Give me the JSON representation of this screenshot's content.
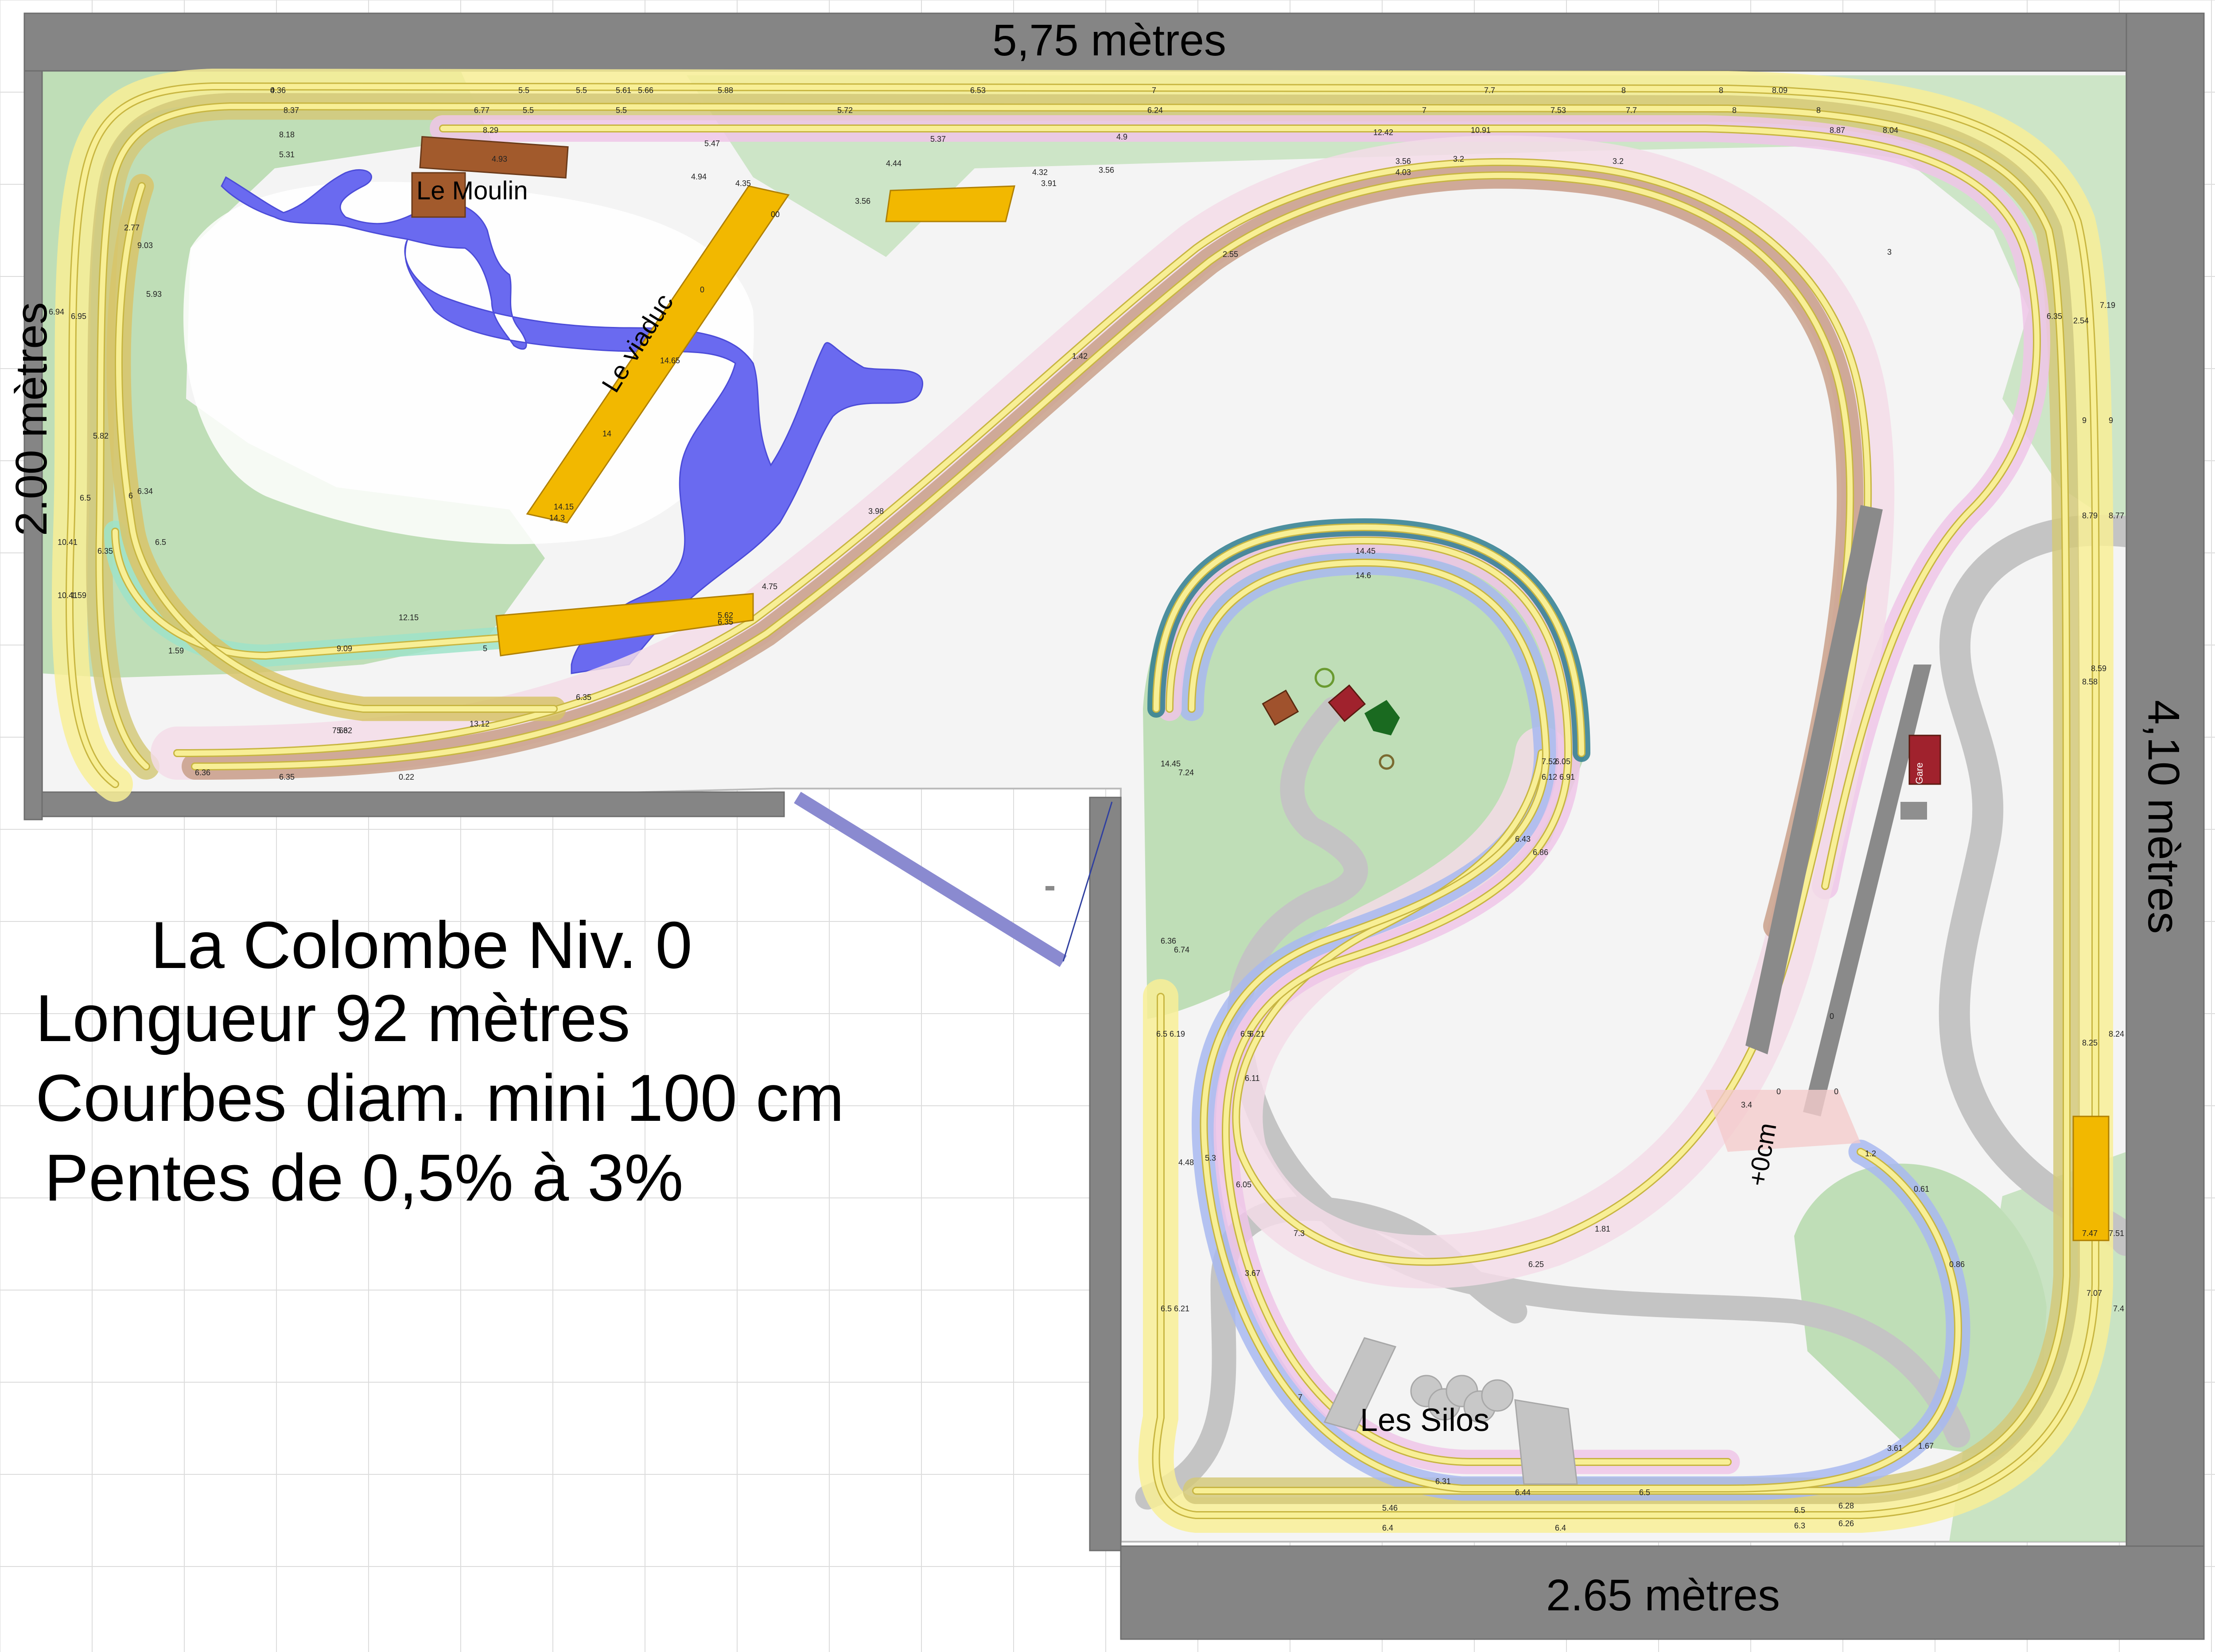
{
  "dimensions": {
    "top": "5,75 mètres",
    "left": "2.00 mètres",
    "right": "4,10 mètres",
    "bottom": "2.65 mètres"
  },
  "title_block": {
    "line1": "La Colombe Niv. 0",
    "line2": "Longueur 92 mètres",
    "line3": "Courbes diam. mini 100 cm",
    "line4": "Pentes de 0,5% à 3%"
  },
  "places": {
    "moulin": "Le Moulin",
    "viaduc": "Le viaduc",
    "silos": "Les Silos",
    "plus_zero": "+0cm",
    "gare": "Gare"
  },
  "track_heights": [
    "4.36",
    "5.5",
    "5.5",
    "5.61",
    "5.66",
    "5.88",
    "6.53",
    "7",
    "7.7",
    "8",
    "8",
    "8.09",
    "8.37",
    "6.77",
    "5.5",
    "5.5",
    "5.72",
    "6.24",
    "7",
    "7.53",
    "7.7",
    "8",
    "8",
    "8.18",
    "8.29",
    "5.37",
    "4.9",
    "12.42",
    "10.91",
    "8.87",
    "8.04",
    "5.31",
    "4.93",
    "5.47",
    "4.94",
    "4.35",
    "4.44",
    "4.32",
    "3.91",
    "3.56",
    "3.56",
    "3.56",
    "4.03",
    "3.2",
    "3.2",
    "3",
    "2.55",
    "1.42",
    "3.98",
    "4.75",
    "5.62",
    "6.35",
    "6.35",
    "6.35",
    "7.19",
    "2.54",
    "9",
    "9",
    "8.79",
    "8.77",
    "8.59",
    "8.58",
    "8.25",
    "8.24",
    "7.47",
    "7.51",
    "7.07",
    "7.4",
    "6.94",
    "6.95",
    "2.77",
    "9.03",
    "5.93",
    "5.82",
    "6",
    "6.34",
    "6.5",
    "6.5",
    "6.35",
    "10.41",
    "10.41",
    "1.59",
    "1.59",
    "9.09",
    "12.15",
    "5",
    "13.12",
    "5.62",
    "7.63",
    "6.36",
    "6.35",
    "0.22",
    "0",
    "0",
    "0",
    "14.65",
    "14",
    "14.15",
    "14.3",
    "14.45",
    "14.6",
    "14.45",
    "7.24",
    "7.52",
    "6.05",
    "6.12",
    "6.91",
    "6.43",
    "6.86",
    "6.36",
    "6.74",
    "6.19",
    "6.5",
    "6.5",
    "6.21",
    "6.11",
    "5.3",
    "6.05",
    "4.48",
    "7.3",
    "3.67",
    "6.21",
    "6.5",
    "7",
    "6.31",
    "6.44",
    "6.5",
    "5.46",
    "6.4",
    "6.4",
    "6.5",
    "6.3",
    "6.28",
    "6.26",
    "6.25",
    "1.81",
    "1.2",
    "0.61",
    "0.86",
    "1.67",
    "3.61",
    "3.4",
    "0",
    "0",
    "0",
    "0"
  ],
  "colors": {
    "track_yellow": "#f8ef96",
    "track_rail": "#c8b642",
    "pink_bed": "#eec6e8",
    "blue_bed": "#a8b8f0",
    "green_scenery": "#b9dcb0",
    "water": "#6a6af0",
    "viaduct": "#f2b800",
    "road": "#c4c4c4",
    "wall": "#858585"
  }
}
